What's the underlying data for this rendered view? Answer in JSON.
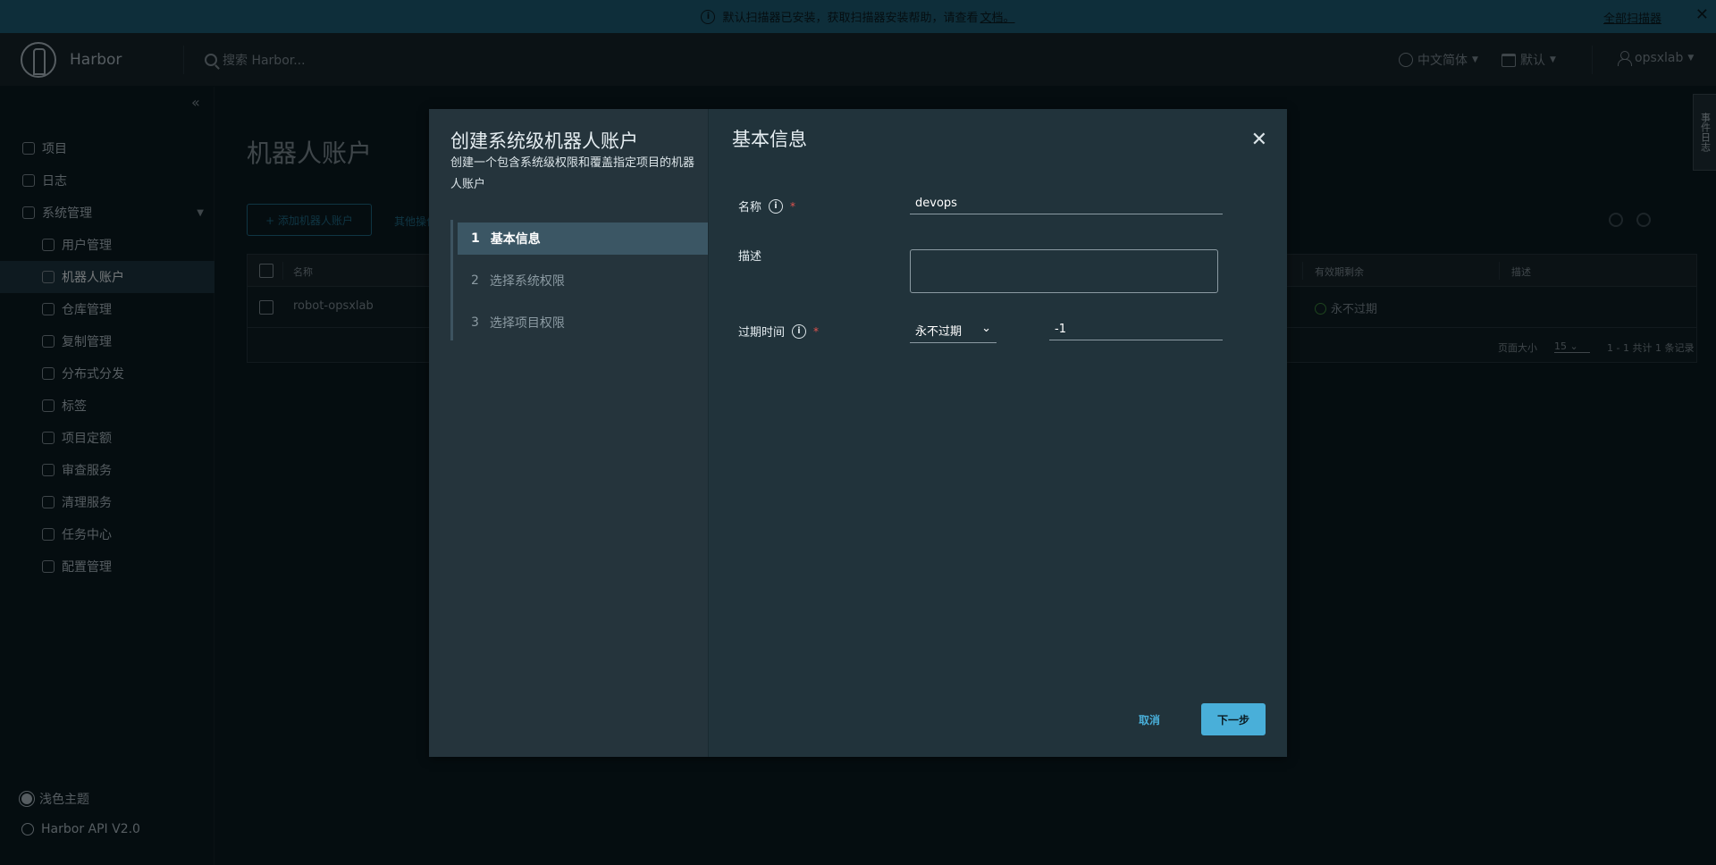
{
  "banner": {
    "message": "默认扫描器已安装，获取扫描器安装帮助，请查看",
    "link": "文档。",
    "scan_all": "全部扫描器",
    "close": "✕"
  },
  "header": {
    "brand": "Harbor",
    "search_placeholder": "搜索 Harbor...",
    "language": "中文简体",
    "datetime": "默认",
    "user": "opsxlab",
    "side_tab": "事件日志"
  },
  "sidebar": {
    "items": [
      {
        "label": "项目"
      },
      {
        "label": "日志"
      },
      {
        "label": "系统管理"
      },
      {
        "label": "用户管理"
      },
      {
        "label": "机器人账户"
      },
      {
        "label": "仓库管理"
      },
      {
        "label": "复制管理"
      },
      {
        "label": "分布式分发"
      },
      {
        "label": "标签"
      },
      {
        "label": "项目定额"
      },
      {
        "label": "审查服务"
      },
      {
        "label": "清理服务"
      },
      {
        "label": "任务中心"
      },
      {
        "label": "配置管理"
      }
    ],
    "theme": "浅色主题",
    "api": "Harbor API V2.0"
  },
  "main": {
    "title": "机器人账户",
    "add_button": "+ 添加机器人账户",
    "other_button": "其他操作",
    "columns": {
      "name": "名称",
      "expires": "有效期剩余",
      "description": "描述"
    },
    "rows": [
      {
        "name": "robot-opsxlab",
        "expires": "永不过期",
        "description": ""
      }
    ],
    "pagination": {
      "page_size_label": "页面大小",
      "page_size": "15",
      "summary": "1 - 1 共计 1 条记录"
    }
  },
  "modal": {
    "title": "创建系统级机器人账户",
    "description": "创建一个包含系统级权限和覆盖指定项目的机器人账户",
    "steps": [
      {
        "num": "1",
        "label": "基本信息"
      },
      {
        "num": "2",
        "label": "选择系统权限"
      },
      {
        "num": "3",
        "label": "选择项目权限"
      }
    ],
    "section_title": "基本信息",
    "fields": {
      "name_label": "名称",
      "name_value": "devops",
      "desc_label": "描述",
      "desc_value": "",
      "expire_label": "过期时间",
      "expire_select": "永不过期",
      "expire_value": "-1"
    },
    "cancel": "取消",
    "next": "下一步"
  }
}
